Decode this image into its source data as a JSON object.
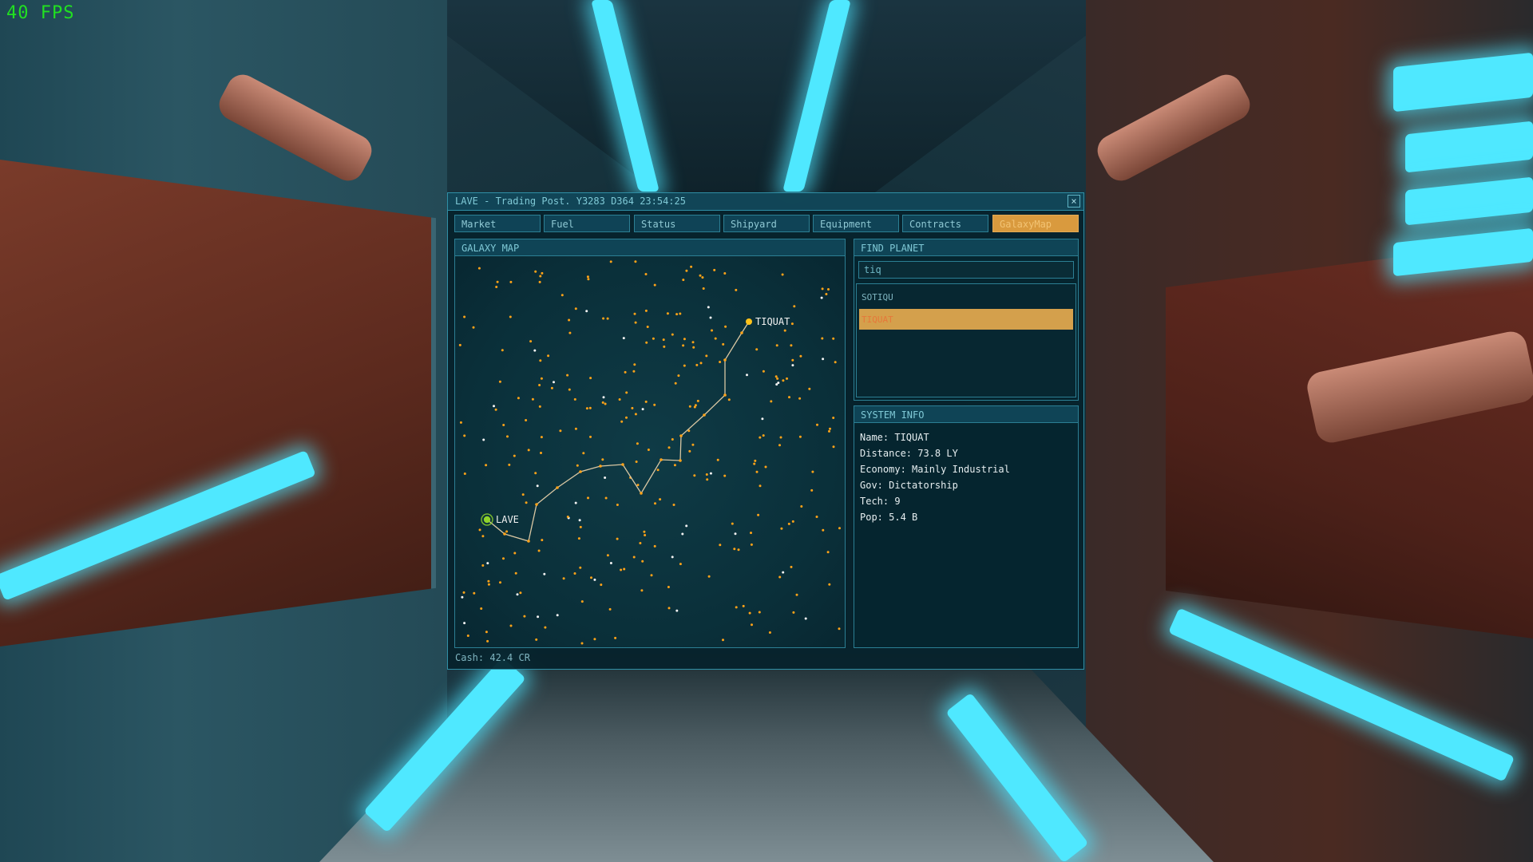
{
  "hud": {
    "fps": "40 FPS"
  },
  "window": {
    "title": "LAVE - Trading Post. Y3283 D364 23:54:25",
    "close_label": "×"
  },
  "tabs": [
    {
      "label": "Market"
    },
    {
      "label": "Fuel"
    },
    {
      "label": "Status"
    },
    {
      "label": "Shipyard"
    },
    {
      "label": "Equipment"
    },
    {
      "label": "Contracts"
    },
    {
      "label": "GalaxyMap",
      "active": true
    }
  ],
  "galaxy_map": {
    "header": "GALAXY MAP",
    "origin": {
      "name": "LAVE",
      "color": "#8fd42a"
    },
    "destination": {
      "name": "TIQUAT",
      "color": "#ffc21a"
    },
    "colors": {
      "star_orange": "#ffa318",
      "star_white": "#f2f2f2",
      "route": "#d9c7a3"
    }
  },
  "find_planet": {
    "header": "FIND PLANET",
    "query": "tiq",
    "results": [
      {
        "label": "SOTIQU",
        "selected": false
      },
      {
        "label": "TIQUAT",
        "selected": true
      }
    ]
  },
  "system_info": {
    "header": "SYSTEM INFO",
    "lines": [
      "Name: TIQUAT",
      "Distance: 73.8 LY",
      "Economy: Mainly Industrial",
      "Gov: Dictatorship",
      "Tech: 9",
      "Pop: 5.4 B"
    ]
  },
  "footer": {
    "cash": "Cash: 42.4 CR"
  },
  "colors": {
    "accent": "#d99a3e",
    "panel_border": "#2c7f94",
    "fps": "#21e021"
  }
}
